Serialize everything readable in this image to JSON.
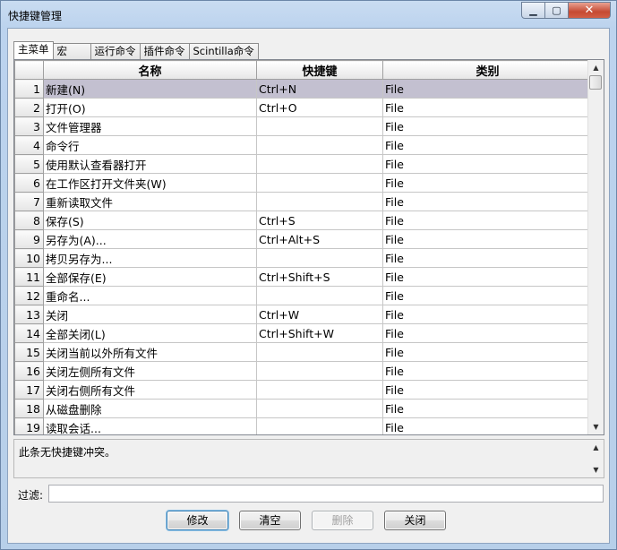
{
  "window": {
    "title": "快捷键管理",
    "minimize_glyph": "▁",
    "maximize_glyph": "▢",
    "close_glyph": "✕"
  },
  "tabs": [
    {
      "label": "主菜单",
      "active": true
    },
    {
      "label": "宏",
      "active": false
    },
    {
      "label": "运行命令",
      "active": false
    },
    {
      "label": "插件命令",
      "active": false
    },
    {
      "label": "Scintilla命令",
      "active": false
    }
  ],
  "grid": {
    "columns": [
      "名称",
      "快捷键",
      "类别"
    ],
    "selected_row": 1,
    "rows": [
      {
        "num": "1",
        "name": "新建(N)",
        "shortcut": "Ctrl+N",
        "category": "File"
      },
      {
        "num": "2",
        "name": "打开(O)",
        "shortcut": "Ctrl+O",
        "category": "File"
      },
      {
        "num": "3",
        "name": "文件管理器",
        "shortcut": "",
        "category": "File"
      },
      {
        "num": "4",
        "name": "命令行",
        "shortcut": "",
        "category": "File"
      },
      {
        "num": "5",
        "name": "使用默认查看器打开",
        "shortcut": "",
        "category": "File"
      },
      {
        "num": "6",
        "name": "在工作区打开文件夹(W)",
        "shortcut": "",
        "category": "File"
      },
      {
        "num": "7",
        "name": "重新读取文件",
        "shortcut": "",
        "category": "File"
      },
      {
        "num": "8",
        "name": "保存(S)",
        "shortcut": "Ctrl+S",
        "category": "File"
      },
      {
        "num": "9",
        "name": "另存为(A)...",
        "shortcut": "Ctrl+Alt+S",
        "category": "File"
      },
      {
        "num": "10",
        "name": "拷贝另存为...",
        "shortcut": "",
        "category": "File"
      },
      {
        "num": "11",
        "name": "全部保存(E)",
        "shortcut": "Ctrl+Shift+S",
        "category": "File"
      },
      {
        "num": "12",
        "name": "重命名...",
        "shortcut": "",
        "category": "File"
      },
      {
        "num": "13",
        "name": "关闭",
        "shortcut": "Ctrl+W",
        "category": "File"
      },
      {
        "num": "14",
        "name": "全部关闭(L)",
        "shortcut": "Ctrl+Shift+W",
        "category": "File"
      },
      {
        "num": "15",
        "name": "关闭当前以外所有文件",
        "shortcut": "",
        "category": "File"
      },
      {
        "num": "16",
        "name": "关闭左侧所有文件",
        "shortcut": "",
        "category": "File"
      },
      {
        "num": "17",
        "name": "关闭右侧所有文件",
        "shortcut": "",
        "category": "File"
      },
      {
        "num": "18",
        "name": "从磁盘删除",
        "shortcut": "",
        "category": "File"
      },
      {
        "num": "19",
        "name": "读取会话...",
        "shortcut": "",
        "category": "File"
      }
    ]
  },
  "status": {
    "text": "此条无快捷键冲突。"
  },
  "filter": {
    "label": "过滤:",
    "value": ""
  },
  "buttons": {
    "modify": "修改",
    "clear": "清空",
    "delete": "删除",
    "close": "关闭"
  },
  "colors": {
    "selected_row": "#c3c0d0",
    "title_bar": "#bcd3ee"
  }
}
